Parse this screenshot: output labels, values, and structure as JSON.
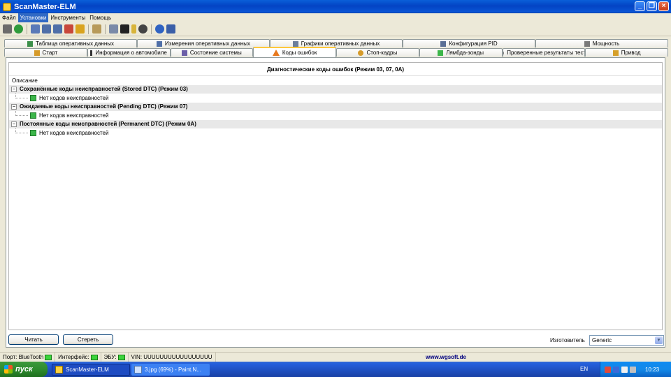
{
  "window": {
    "title": "ScanMaster-ELM"
  },
  "menu": [
    "Файл",
    "Установки",
    "Инструменты",
    "Помощь"
  ],
  "menu_active_index": 1,
  "toolbar": {
    "icons": [
      "wrench-icon",
      "globe-icon",
      "grid-icon",
      "table-icon",
      "table-icon",
      "chart-icon",
      "dollar-icon",
      "clipboard-icon",
      "comment-icon",
      "monitor-icon",
      "battery-icon",
      "gear-icon",
      "info-icon",
      "book-icon"
    ]
  },
  "tabs_row1": [
    {
      "label": "Таблица оперативных данных",
      "icon": "table-icon"
    },
    {
      "label": "Измерения оперативных данных",
      "icon": "grid-icon"
    },
    {
      "label": "Графики оперативных данных",
      "icon": "chart-icon"
    },
    {
      "label": "Конфигурация PID",
      "icon": "config-icon"
    },
    {
      "label": "Мощность",
      "icon": "car-icon"
    }
  ],
  "tabs_row2": [
    {
      "label": "Старт",
      "icon": "home-icon"
    },
    {
      "label": "Информация о автомобиле",
      "icon": "info-icon"
    },
    {
      "label": "Состояние системы",
      "icon": "status-icon"
    },
    {
      "label": "Коды ошибок",
      "icon": "warning-icon",
      "active": true
    },
    {
      "label": "Стоп-кадры",
      "icon": "snapshot-icon"
    },
    {
      "label": "Лямбда-зонды",
      "icon": "sensor-icon"
    },
    {
      "label": "Проверенные результаты теста",
      "icon": "gear-icon"
    },
    {
      "label": "Привод",
      "icon": "drive-icon"
    }
  ],
  "dtc": {
    "title": "Диагностические коды ошибок (Режим 03, 07, 0A)",
    "column_header": "Описание",
    "groups": [
      {
        "label": "Сохранённые коды неисправностей (Stored DTC) (Режим 03)",
        "child": "Нет кодов неисправностей"
      },
      {
        "label": "Ожидаемые коды неисправностей (Pending DTC) (Режим 07)",
        "child": "Нет кодов неисправностей"
      },
      {
        "label": "Постоянные коды неисправностей (Permanent DTC) (Режим 0A)",
        "child": "Нет кодов неисправностей"
      }
    ],
    "expand_symbol": "−"
  },
  "buttons": {
    "read": "Читать",
    "clear": "Стереть"
  },
  "manufacturer": {
    "label": "Изготовитель",
    "value": "Generic"
  },
  "status": {
    "port": "Порт: BlueTooth",
    "interface": "Интерфейс:",
    "ecu": "ЭБУ:",
    "vin": "VIN: UUUUUUUUUUUUUUUUU",
    "url": "www.wgsoft.de"
  },
  "taskbar": {
    "start": "пуск",
    "tasks": [
      {
        "label": "ScanMaster-ELM",
        "active": true
      },
      {
        "label": "3.jpg (69%) - Paint.N...",
        "active": false
      }
    ],
    "lang": "EN",
    "clock": "10:23"
  },
  "colors": {
    "titlebar": "#0a56d6",
    "active_tab_accent": "#ffc83c",
    "ok_green": "#3cb64a",
    "url": "#00007f"
  }
}
